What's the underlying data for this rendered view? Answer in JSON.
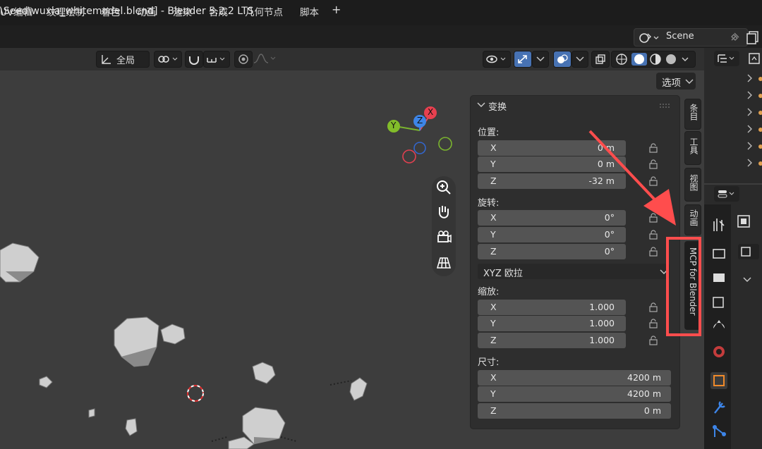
{
  "window": {
    "title": "\\Seed\\wuxia_whitemodel.blend] - Blender 5.2.2 LTS"
  },
  "menu": {
    "items": [
      "UV编辑",
      "纹理绘制",
      "着色",
      "动画",
      "渲染",
      "合成",
      "几何节点",
      "脚本"
    ],
    "add_tab": "+",
    "scene": "Scene"
  },
  "header": {
    "orientation": "全局",
    "options_button": "选项"
  },
  "npanel": {
    "section_title": "变换",
    "location_label": "位置:",
    "location": [
      {
        "axis": "X",
        "value": "0 m"
      },
      {
        "axis": "Y",
        "value": "0 m"
      },
      {
        "axis": "Z",
        "value": "-32 m"
      }
    ],
    "rotation_label": "旋转:",
    "rotation": [
      {
        "axis": "X",
        "value": "0°"
      },
      {
        "axis": "Y",
        "value": "0°"
      },
      {
        "axis": "Z",
        "value": "0°"
      }
    ],
    "rotation_mode": "XYZ 欧拉",
    "scale_label": "缩放:",
    "scale": [
      {
        "axis": "X",
        "value": "1.000"
      },
      {
        "axis": "Y",
        "value": "1.000"
      },
      {
        "axis": "Z",
        "value": "1.000"
      }
    ],
    "dimensions_label": "尺寸:",
    "dimensions": [
      {
        "axis": "X",
        "value": "4200 m"
      },
      {
        "axis": "Y",
        "value": "4200 m"
      },
      {
        "axis": "Z",
        "value": "0 m"
      }
    ]
  },
  "sidebar_tabs": [
    "条目",
    "工具",
    "视图",
    "动画",
    "MCP for Blender"
  ],
  "gizmo": {
    "x": "X",
    "y": "Y",
    "z": "Z"
  },
  "colors": {
    "accent": "#4772b3",
    "highlight": "#ff4d4d"
  }
}
